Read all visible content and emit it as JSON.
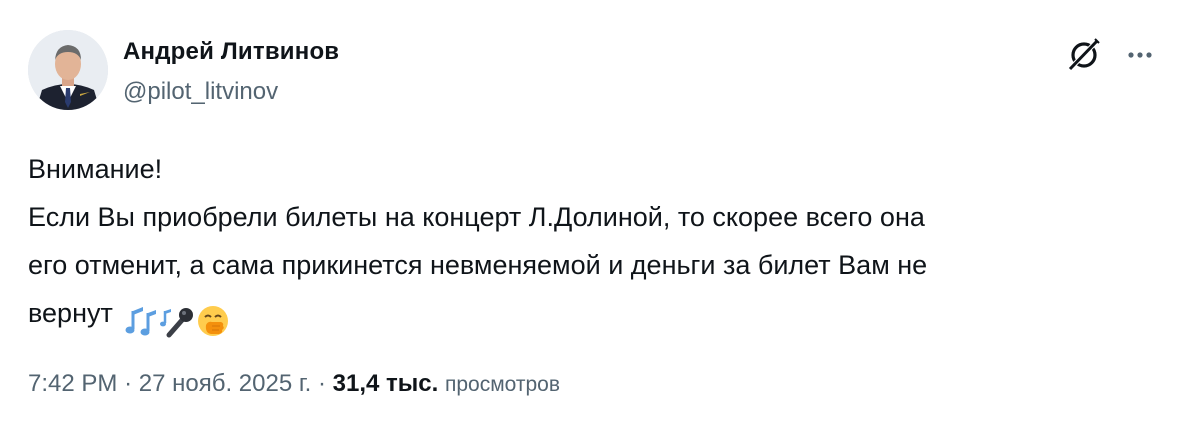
{
  "author": {
    "name": "Андрей Литвинов",
    "handle": "@pilot_litvinov"
  },
  "icons": {
    "grok": "grok-icon",
    "more": "more-icon",
    "emojis": [
      "musical-notes-icon",
      "microphone-icon",
      "face-with-hand-over-mouth-icon"
    ]
  },
  "tweet": {
    "lines": [
      "Внимание!",
      "Если Вы приобрели билеты на концерт Л.Долиной, то скорее всего она",
      "его отменит, а сама прикинется невменяемой и деньги за билет Вам не",
      "вернут"
    ]
  },
  "meta": {
    "time": "7:42 PM",
    "separator": "·",
    "date": "27 нояб. 2025 г.",
    "views_count": "31,4 тыс.",
    "views_label": "просмотров"
  },
  "colors": {
    "text": "#0f1419",
    "muted": "#536471",
    "background": "#ffffff"
  }
}
